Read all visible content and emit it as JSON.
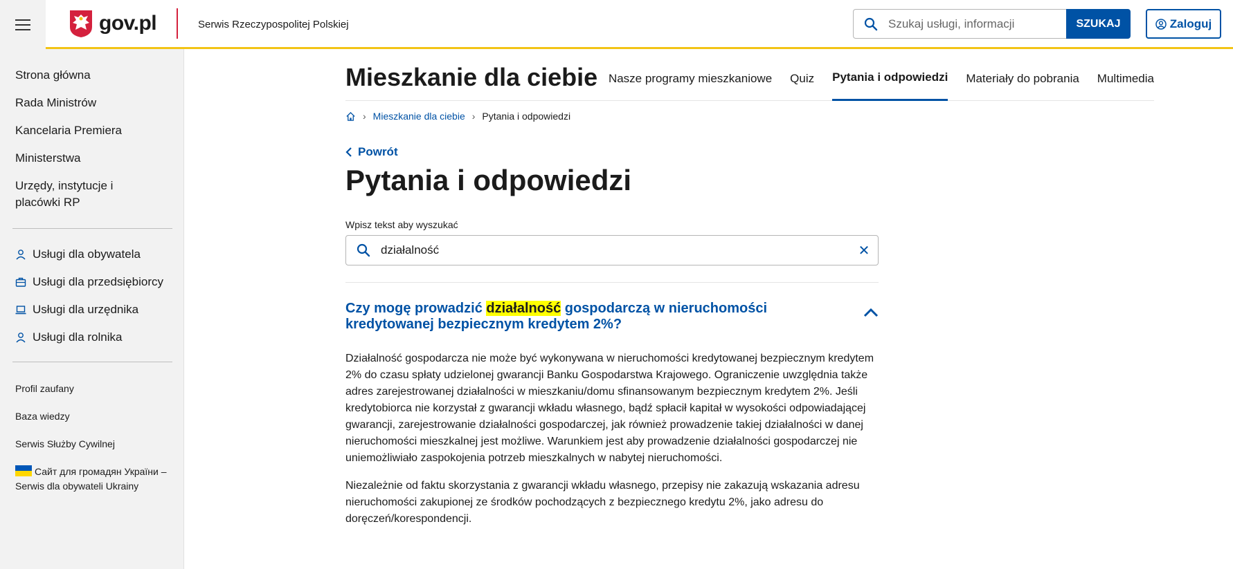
{
  "header": {
    "logo_text": "gov.pl",
    "site_name": "Serwis Rzeczypospolitej Polskiej",
    "search_placeholder": "Szukaj usługi, informacji",
    "search_button": "SZUKAJ",
    "login_button": "Zaloguj"
  },
  "sidebar": {
    "main": [
      "Strona główna",
      "Rada Ministrów",
      "Kancelaria Premiera",
      "Ministerstwa",
      "Urzędy, instytucje i placówki RP"
    ],
    "services": [
      {
        "label": "Usługi dla obywatela",
        "icon": "person-icon"
      },
      {
        "label": "Usługi dla przedsiębiorcy",
        "icon": "briefcase-icon"
      },
      {
        "label": "Usługi dla urzędnika",
        "icon": "laptop-icon"
      },
      {
        "label": "Usługi dla rolnika",
        "icon": "person-icon"
      }
    ],
    "extra": [
      "Profil zaufany",
      "Baza wiedzy",
      "Serwis Służby Cywilnej"
    ],
    "ukraine_link": "Сайт для громадян України –Serwis dla obywateli Ukrainy"
  },
  "subnav": {
    "title": "Mieszkanie dla ciebie",
    "links": [
      "Nasze programy mieszkaniowe",
      "Quiz",
      "Pytania i odpowiedzi",
      "Materiały do pobrania",
      "Multimedia"
    ],
    "active": "Pytania i odpowiedzi"
  },
  "breadcrumb": {
    "link": "Mieszkanie dla ciebie",
    "current": "Pytania i odpowiedzi"
  },
  "back_label": "Powrót",
  "page_title": "Pytania i odpowiedzi",
  "filter": {
    "label": "Wpisz tekst aby wyszukać",
    "value": "działalność"
  },
  "question": {
    "before": "Czy mogę prowadzić ",
    "highlight": "działalność",
    "after": " gospodarczą w nieruchomości kredytowanej bezpiecznym kredytem 2%?"
  },
  "answer": [
    "Działalność gospodarcza nie może być wykonywana w nieruchomości kredytowanej bezpiecznym kredytem 2% do czasu spłaty udzielonej gwarancji Banku Gospodarstwa Krajowego. Ograniczenie uwzględnia także adres zarejestrowanej działalności w mieszkaniu/domu sfinansowanym bezpiecznym kredytem 2%. Jeśli kredytobiorca nie korzystał z gwarancji wkładu własnego, bądź spłacił kapitał w wysokości odpowiadającej gwarancji, zarejestrowanie działalności gospodarczej, jak również prowadzenie takiej działalności w danej nieruchomości mieszkalnej jest możliwe. Warunkiem jest aby prowadzenie działalności gospodarczej nie uniemożliwiało zaspokojenia potrzeb mieszkalnych w nabytej nieruchomości.",
    "Niezależnie od faktu skorzystania z gwarancji wkładu własnego, przepisy nie zakazują wskazania adresu nieruchomości zakupionej ze środków pochodzących z bezpiecznego kredytu 2%, jako adresu do doręczeń/korespondencji."
  ],
  "colors": {
    "brand_blue": "#0052a5",
    "accent_yellow": "#f2c415",
    "highlight": "#ffff00",
    "red": "#d4213d"
  }
}
